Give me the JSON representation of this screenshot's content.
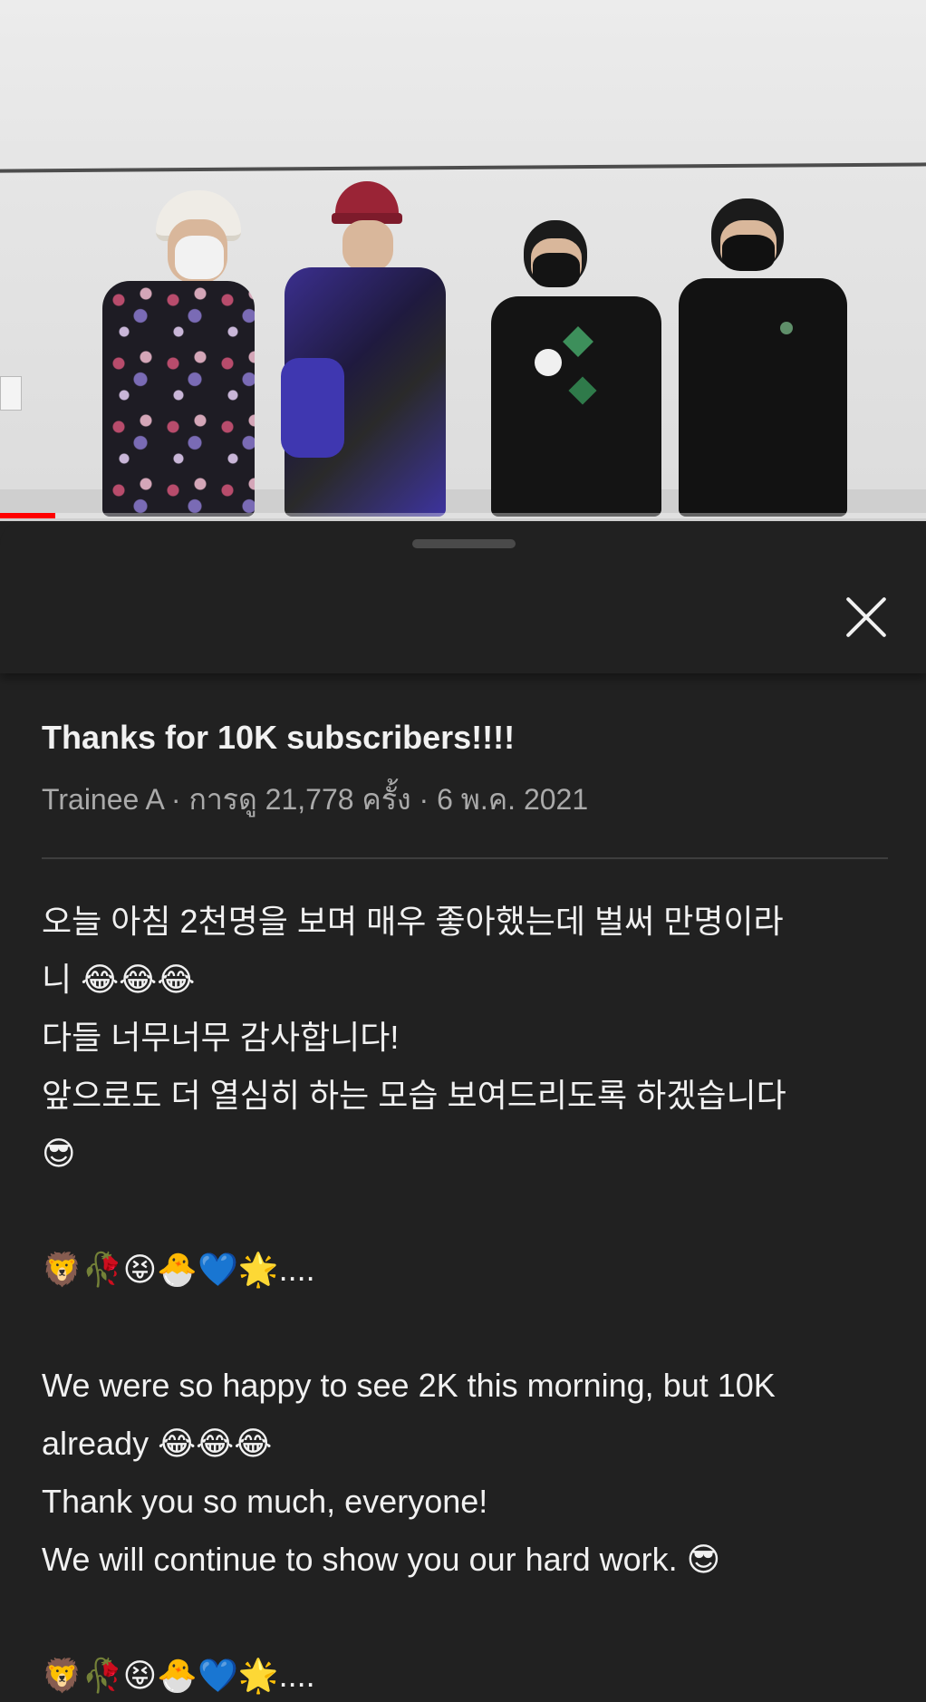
{
  "video": {
    "progress_percent": 6,
    "colors": {
      "wall": "#e6e6e6",
      "progress": "#ff0000"
    }
  },
  "sheet": {
    "close_icon": "close-icon",
    "title": "Thanks for 10K subscribers!!!!",
    "meta": "Trainee A · การดู 21,778 ครั้ง · 6 พ.ค. 2021",
    "description": [
      "오늘 아침 2천명을 보며 매우 좋아했는데 벌써 만명이라",
      "니 😂😂😂",
      "다들 너무너무 감사합니다!",
      "앞으로도 더 열심히 하는 모습 보여드리도록 하겠습니다",
      "😎",
      "",
      "🦁🥀😝🐣💙🌟....",
      "",
      "We were so happy to see 2K this morning, but 10K",
      "already 😂😂😂",
      "Thank you so much, everyone!",
      "We will continue to show you our hard work. 😎",
      "",
      "🦁🥀😝🐣💙🌟...."
    ]
  },
  "colors": {
    "background": "#212121",
    "text_primary": "#f1f1f1",
    "text_secondary": "#aaaaaa",
    "divider": "#3e3e3e"
  }
}
